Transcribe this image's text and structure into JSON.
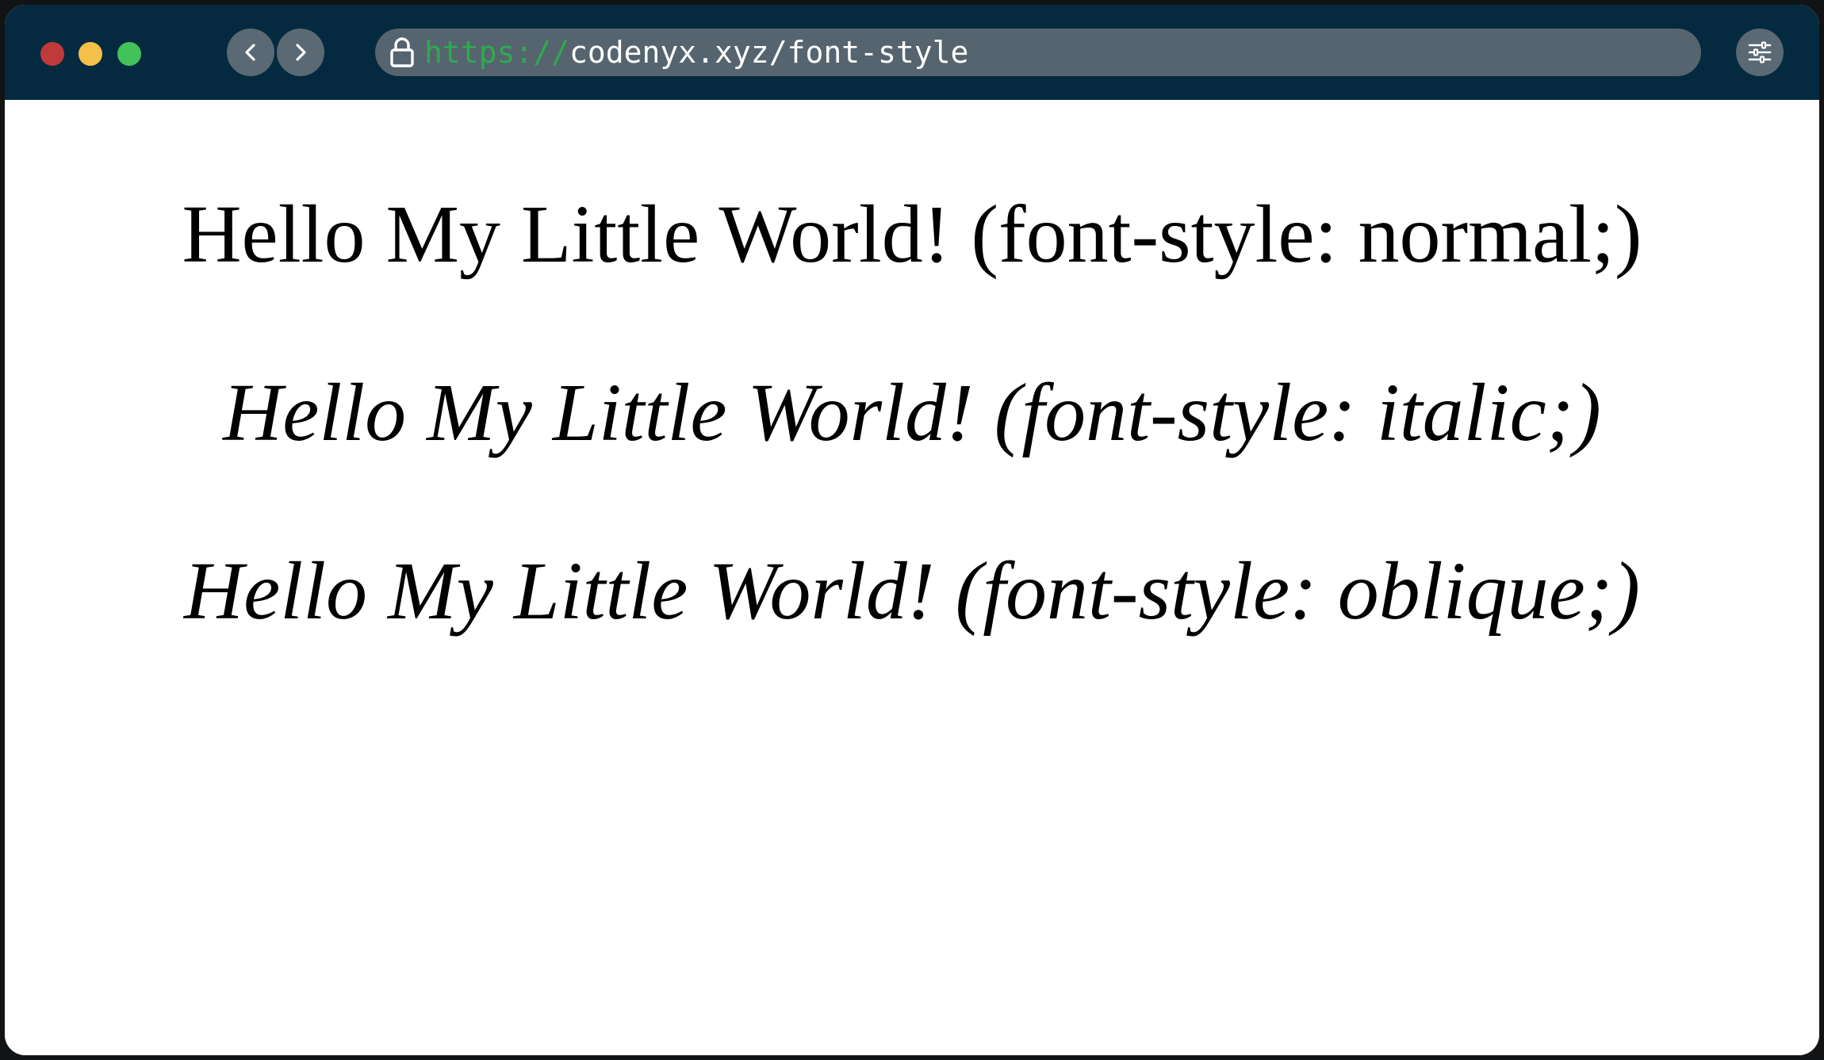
{
  "browser": {
    "traffic_lights": {
      "close_color": "#c0393b",
      "minimize_color": "#f5c04a",
      "maximize_color": "#43c25a"
    },
    "nav": {
      "back_icon": "chevron-left-icon",
      "forward_icon": "chevron-right-icon"
    },
    "address_bar": {
      "lock_icon": "lock-icon",
      "scheme": "https://",
      "url": "codenyx.xyz/font-style",
      "scheme_color": "#2eaa4f"
    },
    "menu_icon": "sliders-icon",
    "titlebar_color": "#052a40"
  },
  "page": {
    "lines": [
      {
        "text": "Hello My Little World! (font-style: normal;)",
        "style": "normal"
      },
      {
        "text": "Hello My Little World! (font-style: italic;)",
        "style": "italic"
      },
      {
        "text": "Hello My Little World! (font-style: oblique;)",
        "style": "oblique"
      }
    ]
  }
}
